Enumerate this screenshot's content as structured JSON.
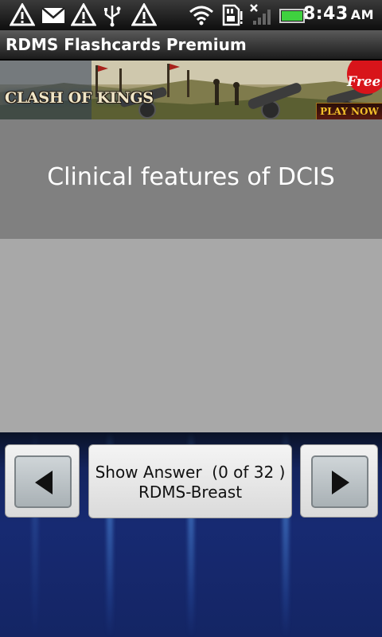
{
  "status_bar": {
    "time": "8:43",
    "ampm": "AM",
    "icons": [
      "warning-icon",
      "mail-icon",
      "warning-icon",
      "usb-icon",
      "warning-icon",
      "wifi-icon",
      "sd-card-icon",
      "no-signal-icon",
      "battery-icon"
    ],
    "battery_color": "#3fd13f"
  },
  "app": {
    "title": "RDMS Flashcards Premium"
  },
  "ad": {
    "logo_text": "CLASH OF KINGS",
    "badge": "Free",
    "cta": "PLAY NOW"
  },
  "card": {
    "question": "Clinical features of DCIS",
    "answer": ""
  },
  "controls": {
    "prev_icon": "arrow-left-icon",
    "next_icon": "arrow-right-icon",
    "show_answer_label": "Show Answer  (0 of 32 )",
    "deck_name": "RDMS-Breast"
  },
  "colors": {
    "question_bg": "#808080",
    "answer_bg": "#a8a8a8",
    "bottom_bg": "#172a72"
  }
}
